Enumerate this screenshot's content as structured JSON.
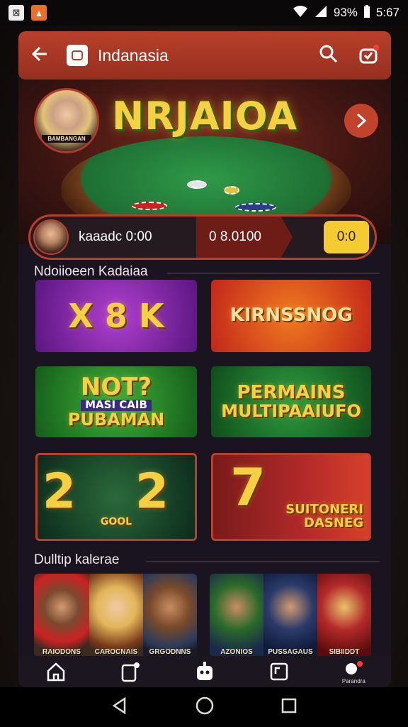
{
  "status_bar": {
    "battery": "93%",
    "time": "5:67"
  },
  "header": {
    "title": "Indanasia"
  },
  "banner": {
    "logo_text": "NRJAIOA",
    "avatar_caption": "BAMBANGAN"
  },
  "wallet": {
    "username": "kaaadc 0:00",
    "balance": "0 8.0100",
    "action": "0:0"
  },
  "section1": {
    "title": "Ndoiioeen Kadaiaa",
    "tiles": [
      {
        "line1": "X 8 K"
      },
      {
        "line1": "KIRNSSNOG"
      },
      {
        "line1": "NOT?",
        "line2": "MASI CAIB",
        "line3": "PUBAMAN"
      },
      {
        "line1": "PERMAINS",
        "line2": "MULTIPAAIUFO"
      },
      {
        "line1": "2 2",
        "line2": "GOOL"
      },
      {
        "line1": "7",
        "line2": "SUITONERI",
        "line3": "DASNEG"
      }
    ]
  },
  "section2": {
    "title": "Dulltip kalerae",
    "people": [
      "RAIODONS",
      "CAROCNAIS",
      "GRGODNNS",
      "AZONIOS",
      "PUSSAGAUS",
      "SIBIIDDT"
    ]
  },
  "nav": {
    "last_label": "Parandra"
  }
}
